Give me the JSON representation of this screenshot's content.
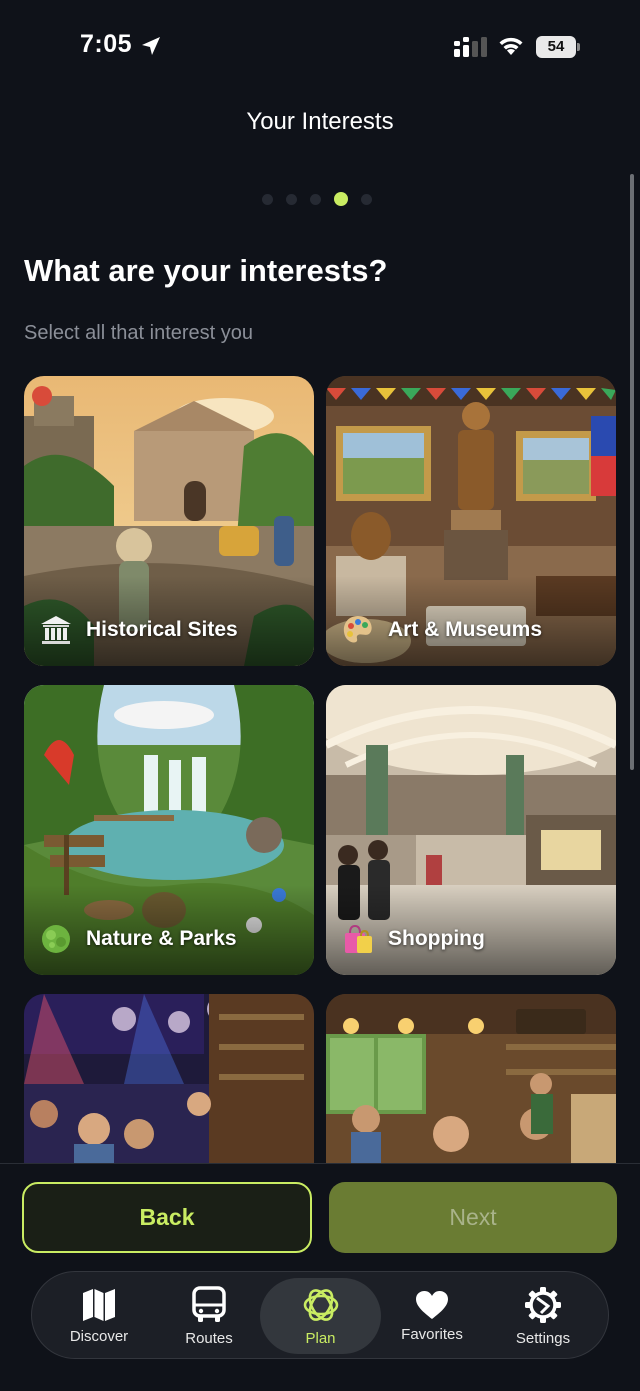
{
  "status_bar": {
    "time": "7:05",
    "battery": "54"
  },
  "header": {
    "title": "Your Interests"
  },
  "progress": {
    "total_steps": 5,
    "current_step": 4
  },
  "main": {
    "heading": "What are your interests?",
    "subheading": "Select all that interest you",
    "interests": [
      {
        "label": "Historical Sites",
        "icon": "classical-building-icon"
      },
      {
        "label": "Art & Museums",
        "icon": "artist-palette-icon"
      },
      {
        "label": "Nature & Parks",
        "icon": "tree-icon"
      },
      {
        "label": "Shopping",
        "icon": "shopping-bags-icon"
      },
      {
        "label": "",
        "icon": ""
      },
      {
        "label": "",
        "icon": ""
      }
    ]
  },
  "footer": {
    "back_label": "Back",
    "next_label": "Next"
  },
  "tabbar": {
    "items": [
      {
        "label": "Discover",
        "icon": "map-icon"
      },
      {
        "label": "Routes",
        "icon": "bus-icon"
      },
      {
        "label": "Plan",
        "icon": "plan-icon",
        "active": true
      },
      {
        "label": "Favorites",
        "icon": "heart-icon"
      },
      {
        "label": "Settings",
        "icon": "gear-icon"
      }
    ]
  },
  "colors": {
    "accent": "#c9ec62",
    "background": "#0f1219",
    "next_button": "#6a7c33"
  }
}
